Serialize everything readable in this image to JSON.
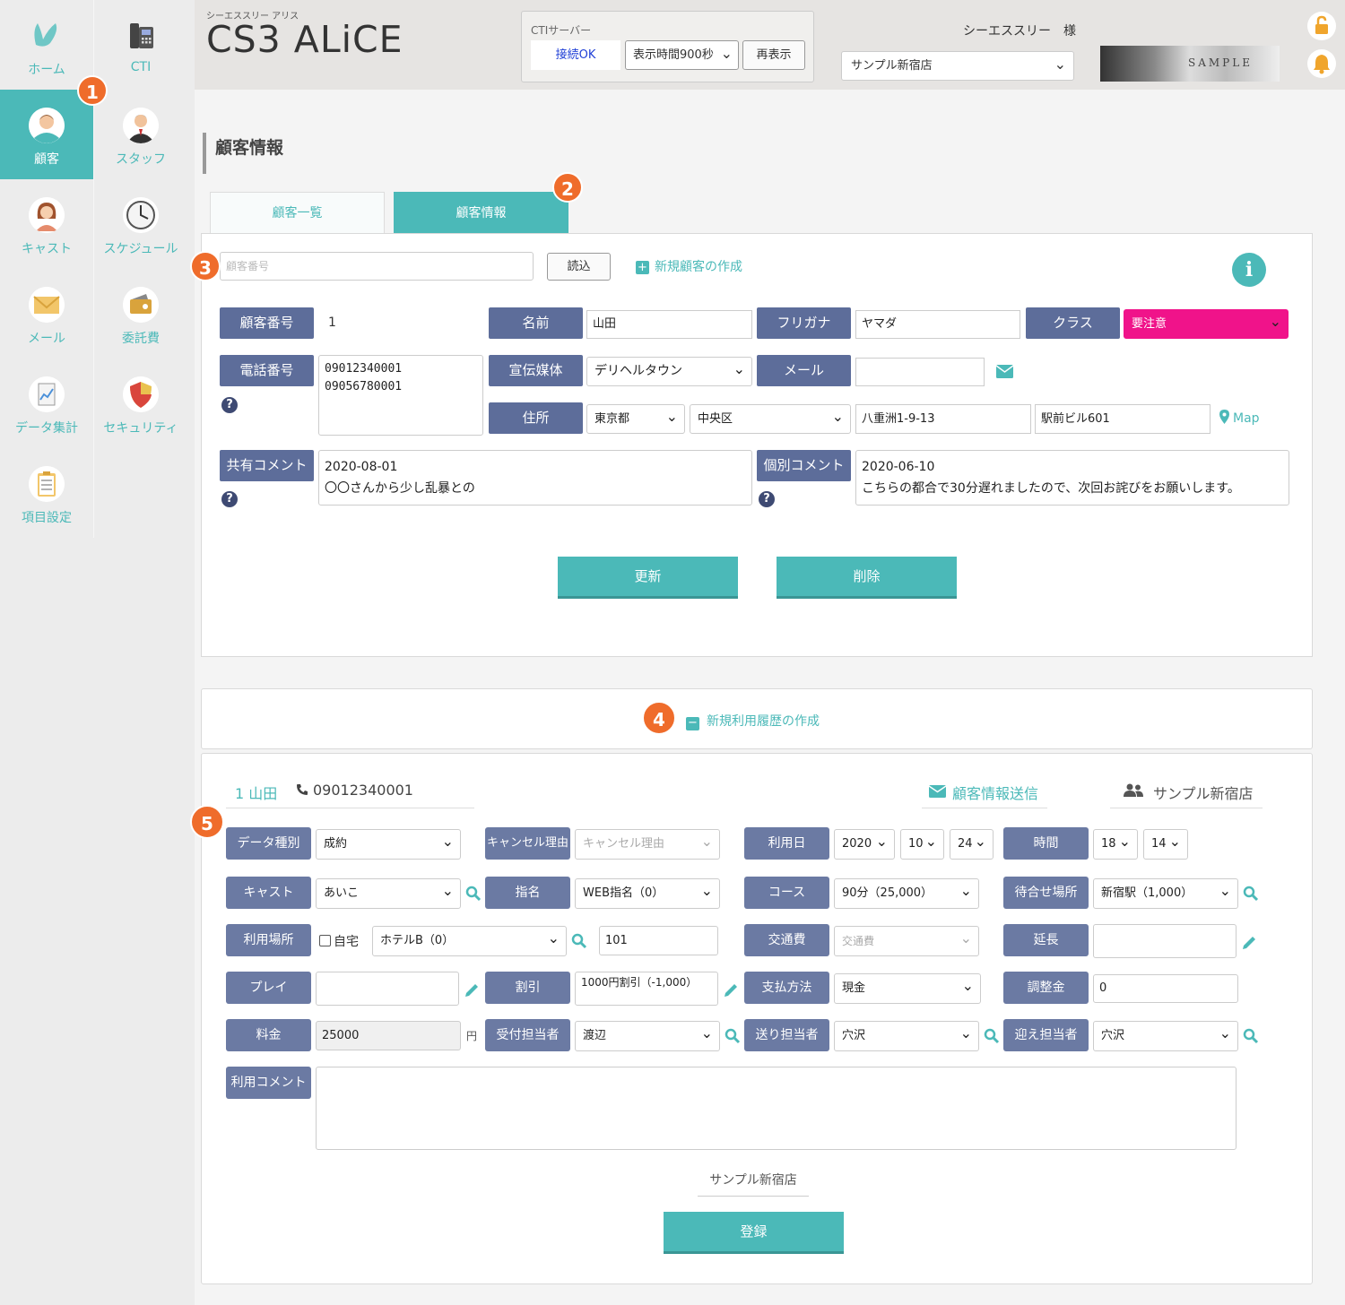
{
  "sidebar": {
    "items": [
      {
        "label": "ホーム"
      },
      {
        "label": "CTI"
      },
      {
        "label": "顧客"
      },
      {
        "label": "スタッフ"
      },
      {
        "label": "キャスト"
      },
      {
        "label": "スケジュール"
      },
      {
        "label": "メール"
      },
      {
        "label": "委託費"
      },
      {
        "label": "データ集計"
      },
      {
        "label": "セキュリティ"
      },
      {
        "label": "項目設定"
      }
    ]
  },
  "badges": [
    "1",
    "2",
    "3",
    "4",
    "5"
  ],
  "header": {
    "app_subtitle": "シーエススリー アリス",
    "app_title": "CS3 ALiCE",
    "cti_label": "CTIサーバー",
    "cti_status": "接続OK",
    "display_time": "表示時間900秒",
    "refresh_label": "再表示",
    "user_name": "シーエススリー　様",
    "store": "サンプル新宿店",
    "banner_text": "SAMPLE"
  },
  "page_title": "顧客情報",
  "tabs": [
    {
      "label": "顧客一覧"
    },
    {
      "label": "顧客情報"
    }
  ],
  "customer": {
    "search_placeholder": "顧客番号",
    "read_label": "読込",
    "new_customer_label": "新規顧客の作成",
    "id_label": "顧客番号",
    "id_value": "1",
    "name_label": "名前",
    "name_value": "山田",
    "kana_label": "フリガナ",
    "kana_value": "ヤマダ",
    "class_label": "クラス",
    "class_value": "要注意",
    "phone_label": "電話番号",
    "phones": [
      "09012340001",
      "09056780001"
    ],
    "media_label": "宣伝媒体",
    "media_value": "デリヘルタウン",
    "mail_label": "メール",
    "mail_value": "",
    "address_label": "住所",
    "prefecture": "東京都",
    "ward": "中央区",
    "street": "八重洲1-9-13",
    "building": "駅前ビル601",
    "map_label": "Map",
    "shared_comment_label": "共有コメント",
    "shared_comment_date": "2020-08-01",
    "shared_comment_text": "〇〇さんから少し乱暴との",
    "private_comment_label": "個別コメント",
    "private_comment_date": "2020-06-10",
    "private_comment_text": "こちらの都合で30分遅れましたので、次回お詫びをお願いします。",
    "update_label": "更新",
    "delete_label": "削除"
  },
  "history": {
    "new_history_label": "新規利用履歴の作成"
  },
  "usage": {
    "customer_ref": "1 山田",
    "customer_phone": "09012340001",
    "send_info_label": "顧客情報送信",
    "store_label": "サンプル新宿店",
    "data_type_label": "データ種別",
    "data_type_value": "成約",
    "cancel_reason_label": "キャンセル理由",
    "cancel_reason_placeholder": "キャンセル理由",
    "use_date_label": "利用日",
    "year": "2020",
    "month": "10",
    "day": "24",
    "time_label": "時間",
    "hour": "18",
    "minute": "14",
    "cast_label": "キャスト",
    "cast_value": "あいこ",
    "nomination_label": "指名",
    "nomination_value": "WEB指名（0）",
    "course_label": "コース",
    "course_value": "90分（25,000）",
    "meet_place_label": "待合せ場所",
    "meet_place_value": "新宿駅（1,000）",
    "use_place_label": "利用場所",
    "home_label": "自宅",
    "hotel_value": "ホテルB（0）",
    "room_value": "101",
    "transport_label": "交通費",
    "transport_placeholder": "交通費",
    "extension_label": "延長",
    "play_label": "プレイ",
    "discount_label": "割引",
    "discount_value": "1000円割引（-1,000）",
    "payment_label": "支払方法",
    "payment_value": "現金",
    "adjust_label": "調整金",
    "adjust_value": "0",
    "fee_label": "料金",
    "fee_value": "25000",
    "yen": "円",
    "reception_label": "受付担当者",
    "reception_value": "渡辺",
    "send_staff_label": "送り担当者",
    "send_staff_value": "穴沢",
    "pickup_staff_label": "迎え担当者",
    "pickup_staff_value": "穴沢",
    "comment_label": "利用コメント",
    "footer_store": "サンプル新宿店",
    "register_label": "登録"
  },
  "colors": {
    "accent": "#4bb9b8",
    "label_bg": "#5d6d9a",
    "badge": "#ef6c2b",
    "class_warning": "#f0138a"
  }
}
